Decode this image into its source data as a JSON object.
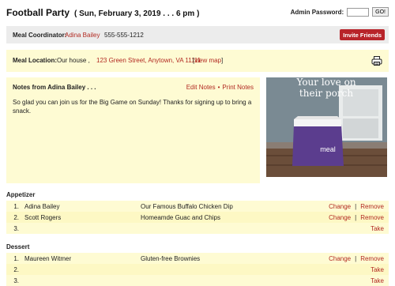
{
  "header": {
    "event_title": "Football Party",
    "event_date": "( Sun, February 3, 2019 . . .  6 pm )",
    "admin_label": "Admin Password:",
    "go_label": "GO!"
  },
  "coordinator": {
    "label": "Meal Coordinator:",
    "name": "Adina Bailey",
    "phone": "555-555-1212",
    "invite_label": "Invite Friends"
  },
  "location": {
    "label": "Meal Location:",
    "place": "Our house ,",
    "address": "123 Green Street, Anytown, VA 11111",
    "map_open": "[",
    "map_label": "view map",
    "map_close": "]"
  },
  "notes": {
    "title": "Notes from Adina Bailey . . .",
    "edit_label": "Edit Notes",
    "sep": "•",
    "print_label": "Print Notes",
    "body": "So glad you can join us for the Big Game on Sunday! Thanks for signing up to bring a snack."
  },
  "ad": {
    "headline_line1": "Your love on",
    "headline_line2": "their porch",
    "box_brand": "meal"
  },
  "sections": [
    {
      "title": "Appetizer",
      "rows": [
        {
          "num": "1.",
          "name": "Adina Bailey",
          "dish": "Our Famous Buffalo Chicken Dip",
          "change": "Change",
          "sep": "|",
          "remove": "Remove"
        },
        {
          "num": "2.",
          "name": "Scott Rogers",
          "dish": "Homeamde Guac and Chips",
          "change": "Change",
          "sep": "|",
          "remove": "Remove"
        },
        {
          "num": "3.",
          "name": "",
          "dish": "",
          "take": "Take"
        }
      ]
    },
    {
      "title": "Dessert",
      "rows": [
        {
          "num": "1.",
          "name": "Maureen Witmer",
          "dish": "Gluten-free Brownies",
          "change": "Change",
          "sep": "|",
          "remove": "Remove"
        },
        {
          "num": "2.",
          "name": "",
          "dish": "",
          "take": "Take"
        },
        {
          "num": "3.",
          "name": "",
          "dish": "",
          "take": "Take"
        }
      ]
    }
  ],
  "colors": {
    "link_red": "#b22a22",
    "invite_button": "#b8242a",
    "yellow_panel": "#fefbd3",
    "grey_bar": "#ececec"
  }
}
